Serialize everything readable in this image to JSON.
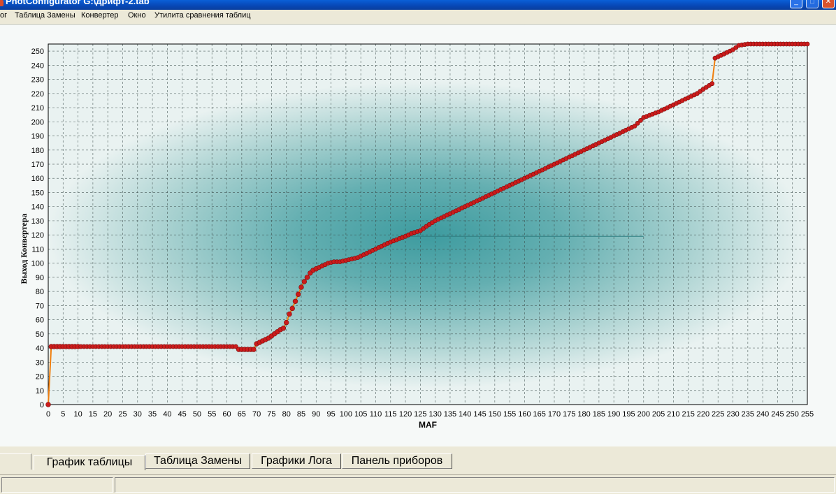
{
  "window": {
    "title": "PhotConfigurator G:\\дрифт-2.tab",
    "minimize_glyph": "_",
    "maximize_glyph": "□",
    "close_glyph": "✕"
  },
  "menu": {
    "items": [
      "ог",
      "Таблица Замены",
      "Конвертер",
      "Окно",
      "Утилита сравнения таблиц"
    ]
  },
  "tabs": {
    "items": [
      "График таблицы",
      "Таблица Замены",
      "Графики Лога",
      "Панель приборов"
    ],
    "active": 0
  },
  "colors": {
    "chart_glow": "#3d9b9f",
    "chart_edge": "#e9f2f1",
    "line": "#f07f0e",
    "marker": "#cc1b1b",
    "grid": "#3a4a48"
  },
  "chart_data": {
    "type": "line",
    "xlabel": "MAF",
    "ylabel": "Выход Конвертера",
    "xlim": [
      0,
      255
    ],
    "ylim": [
      0,
      255
    ],
    "x_ticks": [
      0,
      5,
      10,
      15,
      20,
      25,
      30,
      35,
      40,
      45,
      50,
      55,
      60,
      65,
      70,
      75,
      80,
      85,
      90,
      95,
      100,
      105,
      110,
      115,
      120,
      125,
      130,
      135,
      140,
      145,
      150,
      155,
      160,
      165,
      170,
      175,
      180,
      185,
      190,
      195,
      200,
      205,
      210,
      215,
      220,
      225,
      230,
      235,
      240,
      245,
      250,
      255
    ],
    "y_ticks": [
      0,
      10,
      20,
      30,
      40,
      50,
      60,
      70,
      80,
      90,
      100,
      110,
      120,
      130,
      140,
      150,
      160,
      170,
      180,
      190,
      200,
      210,
      220,
      230,
      240,
      250
    ],
    "grid": true,
    "markers": "circle",
    "series": [
      {
        "points": [
          [
            0,
            0
          ],
          [
            1,
            41
          ],
          [
            5,
            41
          ],
          [
            10,
            41
          ],
          [
            15,
            41
          ],
          [
            20,
            41
          ],
          [
            25,
            41
          ],
          [
            30,
            41
          ],
          [
            35,
            41
          ],
          [
            40,
            41
          ],
          [
            45,
            41
          ],
          [
            50,
            41
          ],
          [
            55,
            41
          ],
          [
            60,
            41
          ],
          [
            63,
            41
          ],
          [
            64,
            39
          ],
          [
            67,
            39
          ],
          [
            69,
            39
          ],
          [
            70,
            43
          ],
          [
            72,
            45
          ],
          [
            74,
            47
          ],
          [
            76,
            50
          ],
          [
            78,
            53
          ],
          [
            79,
            54
          ],
          [
            80,
            58
          ],
          [
            81,
            64
          ],
          [
            82,
            68
          ],
          [
            83,
            73
          ],
          [
            84,
            78
          ],
          [
            85,
            83
          ],
          [
            86,
            87
          ],
          [
            87,
            90
          ],
          [
            88,
            93
          ],
          [
            89,
            95
          ],
          [
            90,
            96
          ],
          [
            92,
            98
          ],
          [
            94,
            100
          ],
          [
            96,
            101
          ],
          [
            98,
            101
          ],
          [
            100,
            102
          ],
          [
            102,
            103
          ],
          [
            104,
            104
          ],
          [
            105,
            105
          ],
          [
            107,
            107
          ],
          [
            110,
            110
          ],
          [
            115,
            115
          ],
          [
            120,
            119
          ],
          [
            122,
            121
          ],
          [
            125,
            123
          ],
          [
            127,
            126
          ],
          [
            130,
            130
          ],
          [
            135,
            135
          ],
          [
            140,
            140
          ],
          [
            145,
            145
          ],
          [
            150,
            150
          ],
          [
            155,
            155
          ],
          [
            160,
            160
          ],
          [
            165,
            165
          ],
          [
            170,
            170
          ],
          [
            175,
            175
          ],
          [
            180,
            180
          ],
          [
            185,
            185
          ],
          [
            190,
            190
          ],
          [
            195,
            195
          ],
          [
            197,
            197
          ],
          [
            200,
            203
          ],
          [
            205,
            207
          ],
          [
            210,
            212
          ],
          [
            215,
            217
          ],
          [
            218,
            220
          ],
          [
            220,
            223
          ],
          [
            223,
            227
          ],
          [
            224,
            245
          ],
          [
            225,
            246
          ],
          [
            230,
            251
          ],
          [
            232,
            254
          ],
          [
            235,
            255
          ],
          [
            240,
            255
          ],
          [
            245,
            255
          ],
          [
            250,
            255
          ],
          [
            255,
            255
          ]
        ]
      }
    ]
  }
}
